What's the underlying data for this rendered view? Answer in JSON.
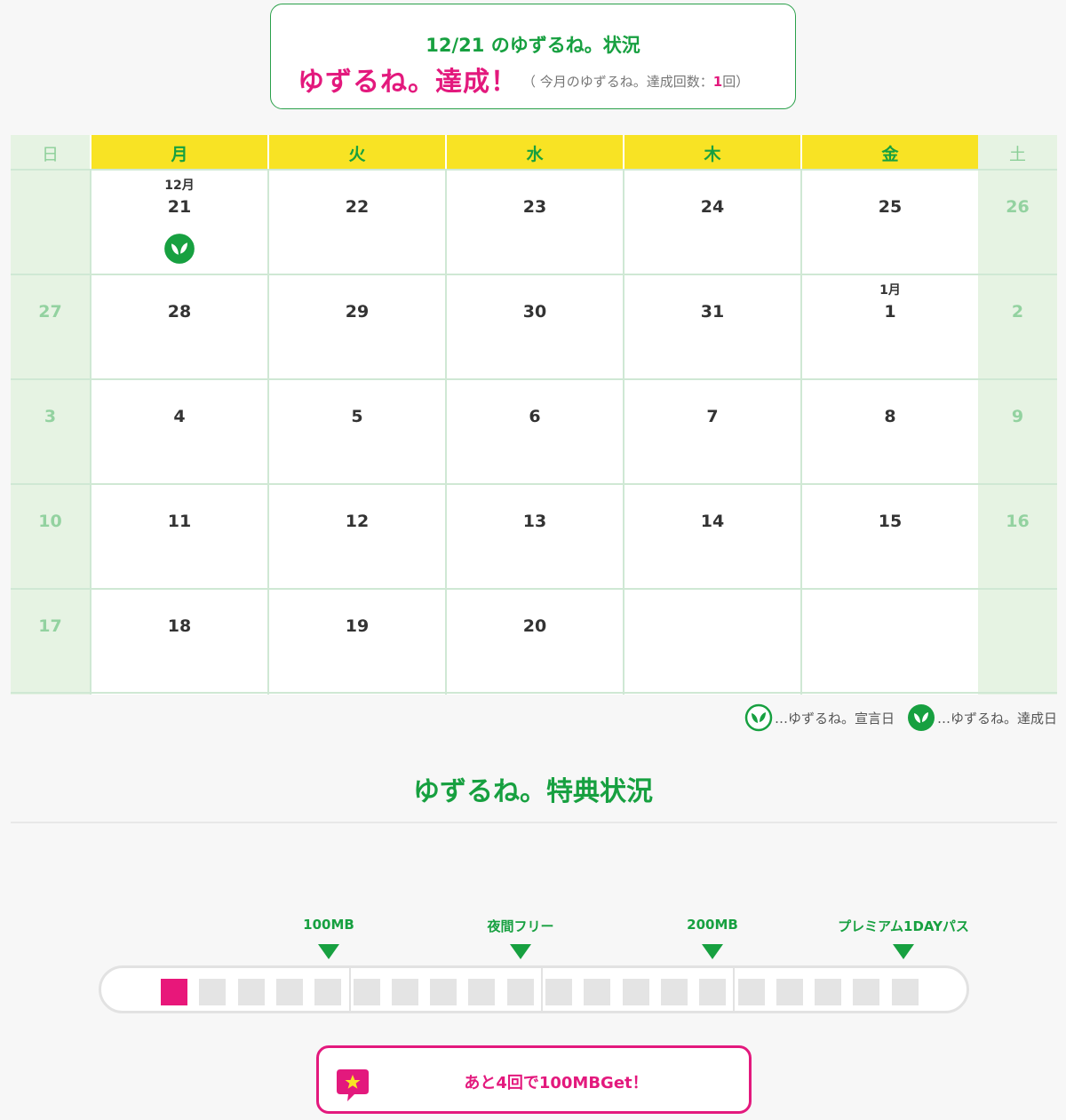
{
  "status": {
    "title": "12/21 のゆずるね。状況",
    "achieved_label": "ゆずるね。達成！",
    "count_prefix": "（ 今月のゆずるね。達成回数：",
    "count_value": "1",
    "count_suffix": "回）"
  },
  "calendar": {
    "weekdays": [
      "日",
      "月",
      "火",
      "水",
      "木",
      "金",
      "土"
    ],
    "weeks": [
      [
        {
          "date": "",
          "month": ""
        },
        {
          "date": "21",
          "month": "12月",
          "stamp": "achieved"
        },
        {
          "date": "22"
        },
        {
          "date": "23"
        },
        {
          "date": "24"
        },
        {
          "date": "25"
        },
        {
          "date": "26"
        }
      ],
      [
        {
          "date": "27"
        },
        {
          "date": "28"
        },
        {
          "date": "29"
        },
        {
          "date": "30"
        },
        {
          "date": "31"
        },
        {
          "date": "1",
          "month": "1月"
        },
        {
          "date": "2"
        }
      ],
      [
        {
          "date": "3"
        },
        {
          "date": "4"
        },
        {
          "date": "5"
        },
        {
          "date": "6"
        },
        {
          "date": "7"
        },
        {
          "date": "8"
        },
        {
          "date": "9"
        }
      ],
      [
        {
          "date": "10"
        },
        {
          "date": "11"
        },
        {
          "date": "12"
        },
        {
          "date": "13"
        },
        {
          "date": "14"
        },
        {
          "date": "15"
        },
        {
          "date": "16"
        }
      ],
      [
        {
          "date": "17"
        },
        {
          "date": "18"
        },
        {
          "date": "19"
        },
        {
          "date": "20"
        },
        {
          "date": ""
        },
        {
          "date": ""
        },
        {
          "date": ""
        }
      ]
    ]
  },
  "legend": {
    "declared_label": "…ゆずるね。宣言日",
    "achieved_label": "…ゆずるね。達成日"
  },
  "benefits": {
    "title": "ゆずるね。特典状況",
    "milestones": [
      "100MB",
      "夜間フリー",
      "200MB",
      "プレミアム1DAYパス"
    ],
    "progress": {
      "filled": 1,
      "total": 20
    },
    "message": "あと4回で100MBGet！"
  },
  "colors": {
    "brand_green": "#17a040",
    "accent_pink": "#e3197d",
    "weekday_header": "#f8e324",
    "weekend_bg": "#e6f3e3"
  }
}
